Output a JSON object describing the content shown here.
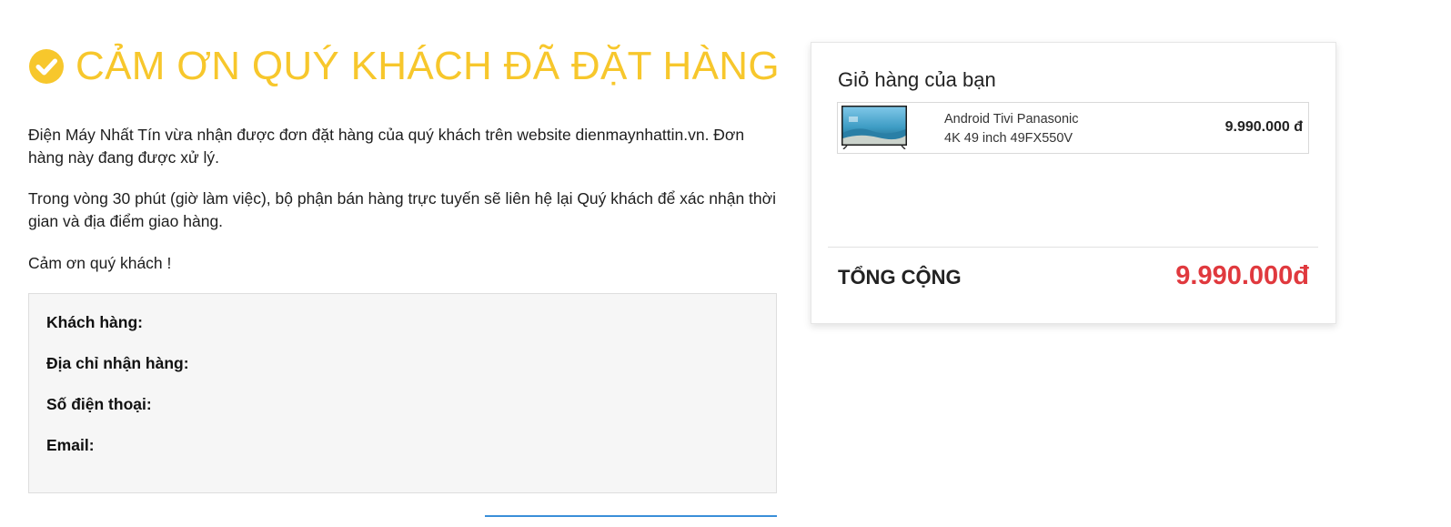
{
  "confirmation": {
    "heading": "CẢM ƠN QUÝ KHÁCH ĐÃ ĐẶT HÀNG",
    "paragraph1": "Điện Máy Nhất Tín vừa nhận được đơn đặt hàng của quý khách trên website dienmaynhattin.vn. Đơn hàng này đang được xử lý.",
    "paragraph2": "Trong vòng 30 phút (giờ làm việc), bộ phận bán hàng trực tuyến sẽ liên hệ lại Quý khách để xác nhận thời gian và địa điểm giao hàng.",
    "paragraph3": "Cảm ơn quý khách !"
  },
  "customer_info": {
    "customer_label": "Khách hàng:",
    "address_label": "Địa chỉ nhận hàng:",
    "phone_label": "Số điện thoại:",
    "email_label": "Email:"
  },
  "cart": {
    "title": "Giỏ hàng của bạn",
    "items": [
      {
        "name_line1": "Android Tivi Panasonic",
        "name_line2": "4K 49 inch 49FX550V",
        "price": "9.990.000 đ"
      }
    ],
    "total_label": "TỔNG CỘNG",
    "total_value": "9.990.000đ"
  },
  "colors": {
    "accent_yellow": "#f7c72c",
    "total_red": "#e0393e",
    "link_blue": "#3a8fd9"
  },
  "icons": {
    "heading_icon": "check-circle-icon",
    "product_thumbnail": "tv-thumbnail"
  }
}
